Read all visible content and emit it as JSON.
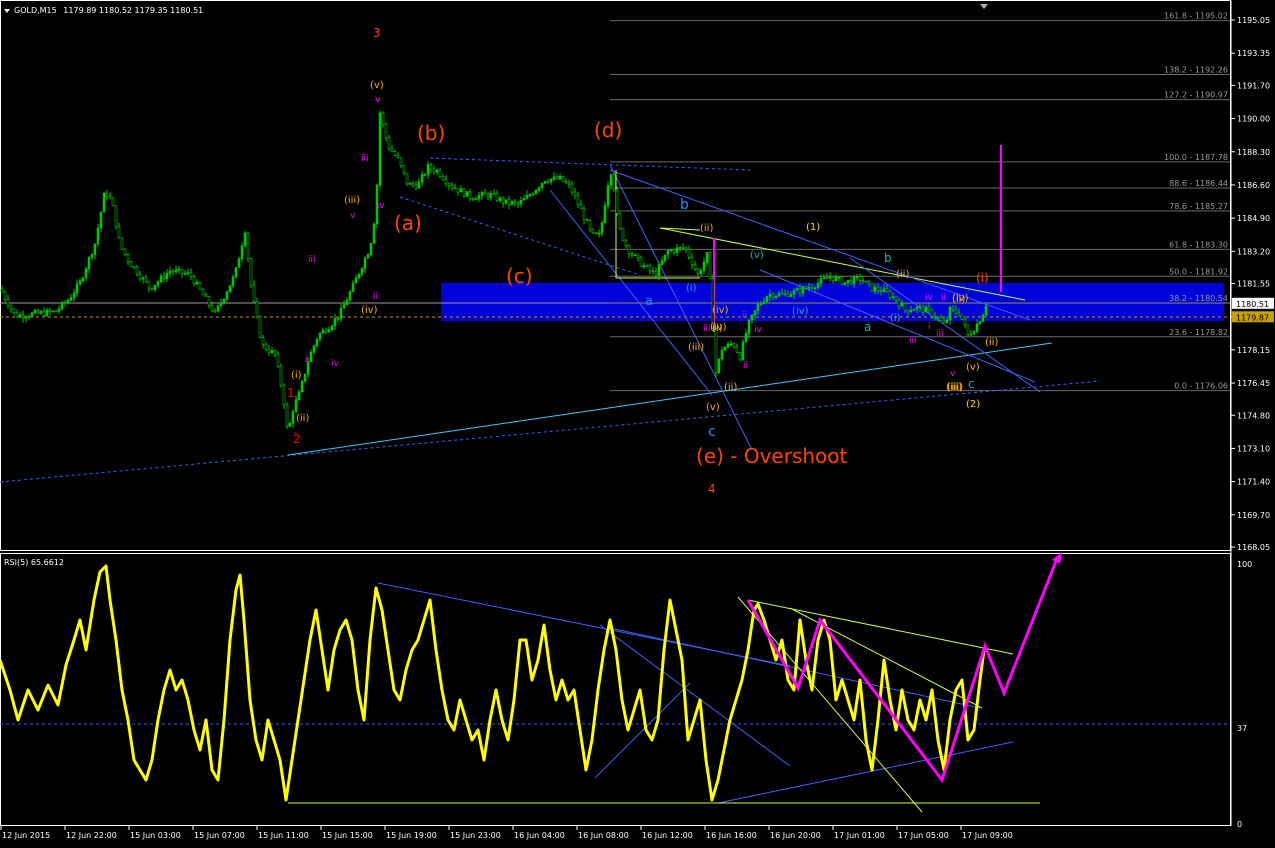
{
  "header": {
    "symbol": "GOLD,M15",
    "ohlc": "1179.89 1180.52 1179.35 1180.51"
  },
  "rsi_header": {
    "name": "RSI(5)",
    "value": "65.6612"
  },
  "colors": {
    "background": "#000000",
    "frame": "#ffffff",
    "bull_candle": "#00c800",
    "zone": "#0000ff",
    "rsi_line": "#ffff00",
    "wave_orange": "#ff4500",
    "wave_magenta": "#ff00ff",
    "wave_cyan": "#1e90ff",
    "wave_yellow": "#ffd700"
  },
  "price_axis": {
    "labels": [
      "1195.05",
      "1193.35",
      "1191.70",
      "1190.00",
      "1188.30",
      "1186.60",
      "1184.90",
      "1183.20",
      "1181.55",
      "1179.85",
      "1178.15",
      "1176.45",
      "1174.80",
      "1173.10",
      "1171.40",
      "1169.70",
      "1168.05"
    ],
    "current_price": "1180.51",
    "bid_line_price": "1179.87"
  },
  "fib_levels": [
    {
      "label": "161.8 - 1195.02"
    },
    {
      "label": "138.2 - 1192.26"
    },
    {
      "label": "127.2 - 1190.97"
    },
    {
      "label": "100.0 - 1187.78"
    },
    {
      "label": "88.6 - 1186.44"
    },
    {
      "label": "78.6 - 1185.27"
    },
    {
      "label": "61.8 - 1183.30"
    },
    {
      "label": "50.0 - 1181.92"
    },
    {
      "label": "38.2 - 1180.54"
    },
    {
      "label": "23.6 - 1178.82"
    },
    {
      "label": "0.0 - 1176.06"
    }
  ],
  "wave_labels": {
    "big": [
      "(a)",
      "(b)",
      "(c)",
      "(d)",
      "(e) - Overshoot"
    ],
    "minor_orange": [
      "3",
      "4",
      "1",
      "2",
      "(i)"
    ],
    "cyan": [
      "b",
      "a",
      "c",
      "b",
      "a",
      "c"
    ],
    "roman_yellow": [
      "(v)",
      "(iii)",
      "(ii)",
      "(i)",
      "(iv)",
      "(i)",
      "(ii)",
      "(iii)",
      "(iv)",
      "(v)",
      "(iv)",
      "(v)",
      "(ii)",
      "(ii)",
      "(ii)",
      "(iii)",
      "(iv)",
      "(1)",
      "(2)",
      "(i)",
      "(v)",
      "(ii)",
      "(i)",
      "(iv)",
      "(iii)"
    ],
    "roman_magenta": [
      "v",
      "iii",
      "iv",
      "iii",
      "v",
      "ii",
      "i",
      "iv",
      "ii",
      "iii",
      "ii",
      "iv",
      "v",
      "iii",
      "ii",
      "iv",
      "i",
      "iii"
    ]
  },
  "rsi_axis": {
    "labels": [
      "100",
      "37",
      "0"
    ]
  },
  "time_axis": {
    "labels": [
      "12 Jun 2015",
      "12 Jun 22:00",
      "15 Jun 03:00",
      "15 Jun 07:00",
      "15 Jun 11:00",
      "15 Jun 15:00",
      "15 Jun 19:00",
      "15 Jun 23:00",
      "16 Jun 04:00",
      "16 Jun 08:00",
      "16 Jun 12:00",
      "16 Jun 16:00",
      "16 Jun 20:00",
      "17 Jun 01:00",
      "17 Jun 05:00",
      "17 Jun 09:00"
    ]
  },
  "chart_data": {
    "type": "candlestick",
    "symbol": "GOLD",
    "timeframe": "M15",
    "ylim": [
      1168.05,
      1195.05
    ],
    "close_path": [
      [
        0,
        1181.3
      ],
      [
        15,
        1179.9
      ],
      [
        35,
        1180.0
      ],
      [
        55,
        1180.1
      ],
      [
        68,
        1180.7
      ],
      [
        80,
        1181.6
      ],
      [
        95,
        1183.6
      ],
      [
        105,
        1186.3
      ],
      [
        112,
        1185.7
      ],
      [
        120,
        1183.5
      ],
      [
        130,
        1182.6
      ],
      [
        150,
        1181.3
      ],
      [
        170,
        1182.2
      ],
      [
        190,
        1182.0
      ],
      [
        215,
        1180.0
      ],
      [
        235,
        1182.0
      ],
      [
        245,
        1184.3
      ],
      [
        252,
        1181.0
      ],
      [
        262,
        1178.4
      ],
      [
        275,
        1177.9
      ],
      [
        283,
        1175.9
      ],
      [
        288,
        1173.7
      ],
      [
        292,
        1175.0
      ],
      [
        300,
        1176.0
      ],
      [
        308,
        1177.6
      ],
      [
        318,
        1178.9
      ],
      [
        330,
        1179.4
      ],
      [
        340,
        1180.0
      ],
      [
        352,
        1181.3
      ],
      [
        363,
        1182.6
      ],
      [
        370,
        1183.4
      ],
      [
        376,
        1185.4
      ],
      [
        380,
        1190.3
      ],
      [
        388,
        1188.6
      ],
      [
        398,
        1187.9
      ],
      [
        408,
        1186.6
      ],
      [
        418,
        1186.6
      ],
      [
        428,
        1187.5
      ],
      [
        438,
        1187.3
      ],
      [
        450,
        1186.6
      ],
      [
        470,
        1186.0
      ],
      [
        490,
        1186.1
      ],
      [
        505,
        1185.7
      ],
      [
        518,
        1185.6
      ],
      [
        530,
        1186.1
      ],
      [
        545,
        1186.9
      ],
      [
        560,
        1186.9
      ],
      [
        570,
        1186.5
      ],
      [
        582,
        1185.2
      ],
      [
        592,
        1184.0
      ],
      [
        600,
        1184.0
      ],
      [
        608,
        1186.7
      ],
      [
        612,
        1187.5
      ],
      [
        618,
        1184.5
      ],
      [
        628,
        1183.3
      ],
      [
        640,
        1182.6
      ],
      [
        655,
        1182.0
      ],
      [
        668,
        1183.2
      ],
      [
        685,
        1183.4
      ],
      [
        698,
        1182.0
      ],
      [
        708,
        1183.1
      ],
      [
        712,
        1180.2
      ],
      [
        716,
        1177.0
      ],
      [
        722,
        1178.2
      ],
      [
        733,
        1178.5
      ],
      [
        740,
        1177.8
      ],
      [
        748,
        1179.4
      ],
      [
        758,
        1180.4
      ],
      [
        768,
        1181.0
      ],
      [
        785,
        1181.0
      ],
      [
        800,
        1181.2
      ],
      [
        815,
        1181.5
      ],
      [
        830,
        1181.9
      ],
      [
        845,
        1181.6
      ],
      [
        860,
        1181.8
      ],
      [
        872,
        1181.3
      ],
      [
        882,
        1181.2
      ],
      [
        895,
        1180.8
      ],
      [
        905,
        1180.2
      ],
      [
        915,
        1180.3
      ],
      [
        925,
        1180.2
      ],
      [
        935,
        1179.9
      ],
      [
        945,
        1179.4
      ],
      [
        950,
        1180.2
      ],
      [
        960,
        1180.0
      ],
      [
        968,
        1178.9
      ],
      [
        975,
        1179.3
      ],
      [
        982,
        1179.9
      ],
      [
        986,
        1180.5
      ]
    ],
    "rsi_period": 5,
    "rsi_last": 65.6612,
    "rsi_level": 37,
    "rsi_ylim": [
      0,
      100
    ],
    "zone_range": [
      1179.8,
      1181.95
    ],
    "annotations": [
      "(a)",
      "(b)",
      "(c)",
      "(d)",
      "(e) - Overshoot"
    ]
  }
}
